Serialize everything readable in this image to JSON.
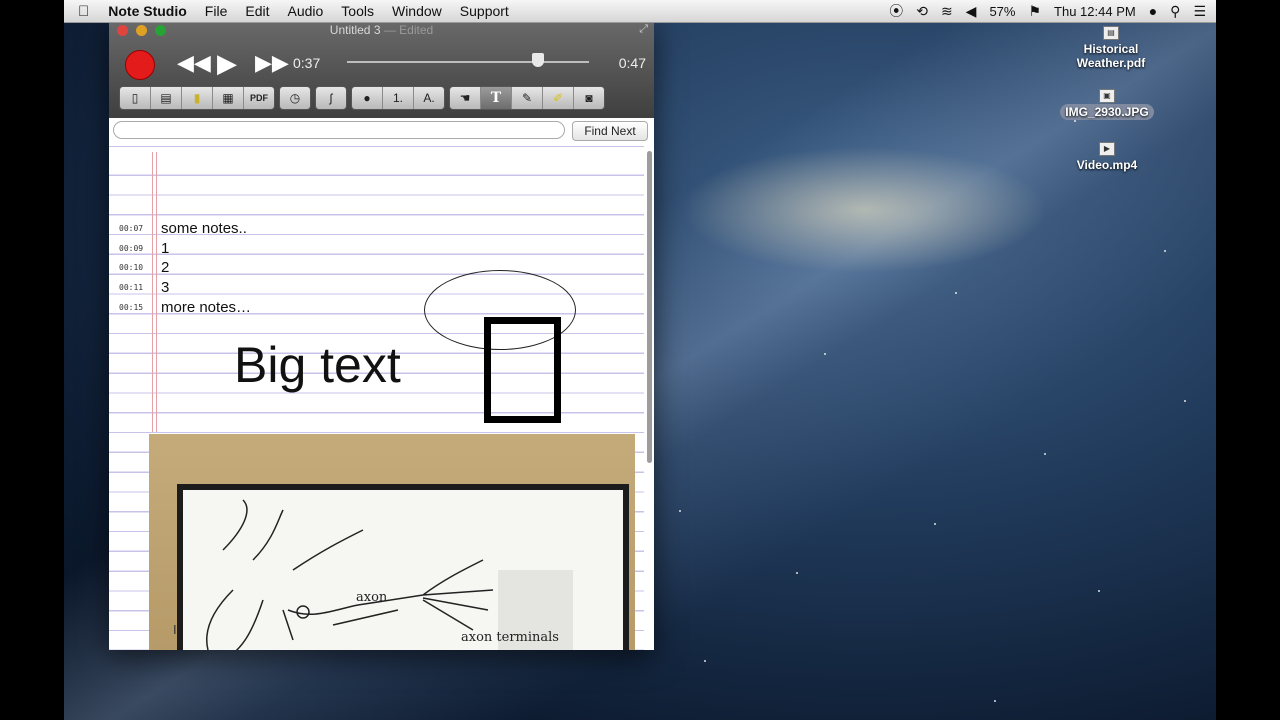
{
  "menubar": {
    "apple": "",
    "app_name": "Note Studio",
    "menus": [
      "File",
      "Edit",
      "Audio",
      "Tools",
      "Window",
      "Support"
    ],
    "battery": "57%",
    "clock": "Thu 12:44 PM"
  },
  "desktop": {
    "icons": [
      {
        "label": "Historical Weather.pdf"
      },
      {
        "label": "IMG_2930.JPG"
      },
      {
        "label": "Video.mp4"
      }
    ]
  },
  "window": {
    "title": "Untitled 3",
    "title_suffix": "— Edited",
    "transport": {
      "current_time": "0:37",
      "total_time": "0:47",
      "progress_fraction": 0.79
    },
    "toolbar": {
      "buttons": [
        "white-paper",
        "blue-lined-paper",
        "yellow-paper",
        "grid-paper",
        "PDF",
        "clock",
        "ʃ",
        "●",
        "1.",
        "A.",
        "hand",
        "T",
        "pen",
        "highlighter",
        "camera"
      ],
      "active": "T"
    },
    "search": {
      "placeholder": "",
      "find_next_label": "Find Next"
    }
  },
  "notes": [
    {
      "time": "00:07",
      "text": "some notes.."
    },
    {
      "time": "00:09",
      "text": "1"
    },
    {
      "time": "00:10",
      "text": "2"
    },
    {
      "time": "00:11",
      "text": "3"
    },
    {
      "time": "00:15",
      "text": "more notes…"
    }
  ],
  "big_text": "Big text",
  "photo_labels": {
    "axon": "axon",
    "axon_terminals": "axon terminals"
  }
}
